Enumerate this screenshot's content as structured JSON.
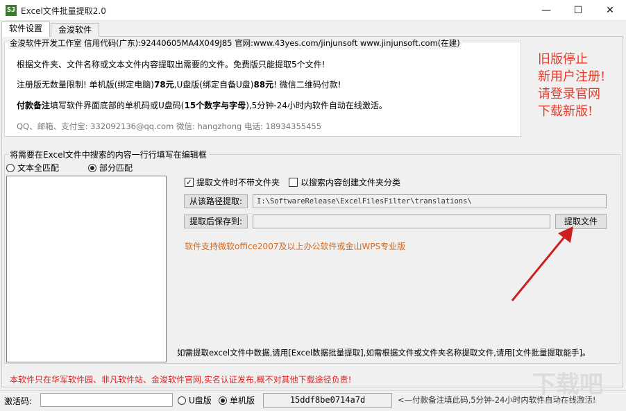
{
  "window": {
    "icon_text": "SJ",
    "title": "Excel文件批量提取2.0",
    "minimize": "—",
    "maximize": "☐",
    "close": "✕"
  },
  "tabs": [
    {
      "label": "软件设置",
      "active": true
    },
    {
      "label": "金浚软件",
      "active": false
    }
  ],
  "info": {
    "legend": "金浚软件开发工作室 信用代码(广东):92440605MA4X049J85 官网:www.43yes.com/jinjunsoft  www.jinjunsoft.com(在建)",
    "line1": "根据文件夹、文件名称或文本文件内容提取出需要的文件。免费版只能提取5个文件!",
    "line2_a": "注册版无数量限制! 单机版(绑定电脑)",
    "line2_price1": "78元",
    "line2_b": ",U盘版(绑定自备U盘)",
    "line2_price2": "88元",
    "line2_c": "! 微信二维码付款!",
    "line3_bold": "付款备注",
    "line3_a": "填写软件界面底部的单机码或U盘码(",
    "line3_bold2": "15个数字与字母",
    "line3_b": "),5分钟-24小时内软件自动在线激活。",
    "contact": "QQ、邮箱、支付宝: 332092136@qq.com  微信: hangzhong  电话: 18934355455"
  },
  "notice_lines": [
    "旧版停止",
    "新用户注册!",
    "请登录官网",
    "下载新版!"
  ],
  "search": {
    "legend": "将需要在Excel文件中搜索的内容一行行填写在编辑框",
    "radio_full": "文本全匹配",
    "radio_partial": "部分匹配",
    "selected_mode": "部分匹配"
  },
  "options": {
    "no_folder_label": "提取文件时不带文件夹",
    "no_folder_checked": true,
    "create_folder_label": "以搜索内容创建文件夹分类",
    "create_folder_checked": false,
    "from_path_button": "从该路径提取:",
    "from_path_value": "I:\\SoftwareRelease\\ExcelFilesFilter\\translations\\",
    "save_to_button": "提取后保存到:",
    "save_to_value": "",
    "extract_button": "提取文件",
    "support_note": "软件支持微软office2007及以上办公软件或金山WPS专业版",
    "help_text": "如需提取excel文件中数据,请用[Excel数据批量提取],如需根据文件或文件夹名称提取文件,请用[文件批量提取能手]。"
  },
  "warning": "本软件只在华军软件园、非凡软件站、金浚软件官网,实名认证发布,概不对其他下载途径负责!",
  "status": {
    "activation_label": "激活码:",
    "activation_value": "",
    "usb_label": "U盘版",
    "standalone_label": "单机版",
    "selected_edition": "单机版",
    "machine_code": "15ddf8be0714a7d",
    "payment_hint": "<—付款备注填此码,5分钟-24小时内软件自动在线激活!"
  },
  "watermark_text": "下载吧",
  "colors": {
    "accent_red": "#e43b2c",
    "note_orange": "#d2691e",
    "arrow": "#cc1f1f"
  }
}
